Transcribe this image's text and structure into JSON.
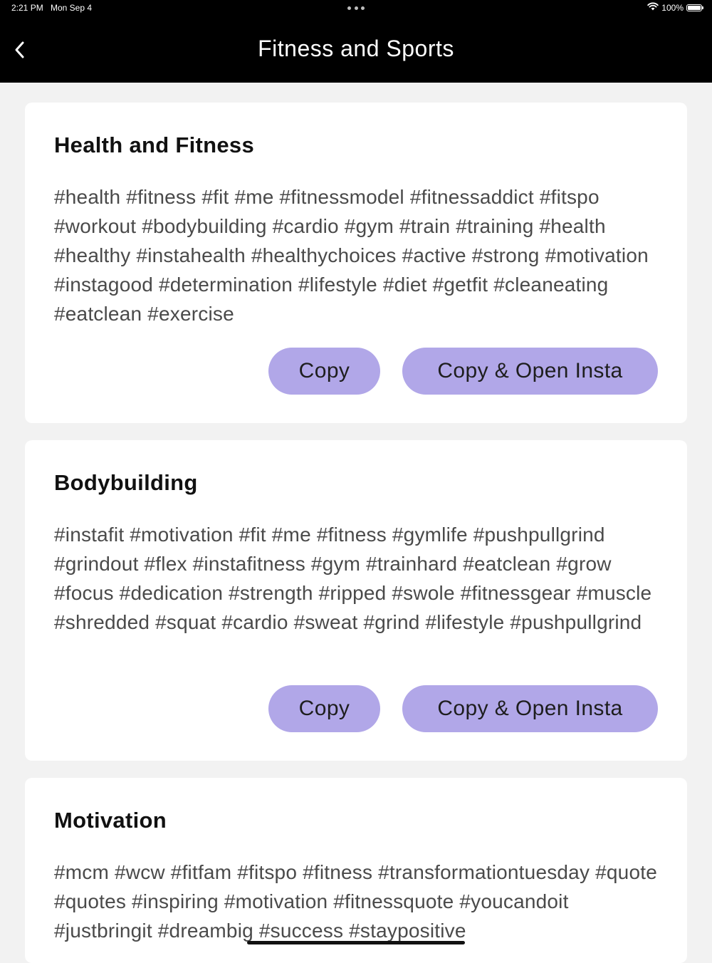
{
  "status_bar": {
    "time": "2:21 PM",
    "date": "Mon Sep 4",
    "battery": "100%"
  },
  "nav": {
    "title": "Fitness and Sports"
  },
  "cards": [
    {
      "title": "Health and Fitness",
      "tags": "#health #fitness #fit #me #fitnessmodel #fitnessaddict #fitspo #workout #bodybuilding #cardio #gym #train #training #health #healthy #instahealth #healthychoices #active #strong #motivation #instagood #determination #lifestyle #diet #getfit #cleaneating #eatclean #exercise",
      "copy_label": "Copy",
      "open_label": "Copy & Open Insta"
    },
    {
      "title": "Bodybuilding",
      "tags": "#instafit #motivation #fit #me #fitness #gymlife #pushpullgrind #grindout #flex #instafitness #gym #trainhard #eatclean #grow #focus #dedication #strength #ripped #swole #fitnessgear #muscle #shredded #squat #cardio #sweat #grind #lifestyle #pushpullgrind",
      "copy_label": "Copy",
      "open_label": "Copy & Open Insta"
    },
    {
      "title": "Motivation",
      "tags": "#mcm #wcw #fitfam #fitspo #fitness #transformationtuesday #quote #quotes #inspiring #motivation #fitnessquote #youcandoit #justbringit #dreambig #success #staypositive"
    }
  ],
  "colors": {
    "button_bg": "#b1a7e8",
    "nav_bg": "#000000",
    "page_bg": "#f2f2f2"
  }
}
